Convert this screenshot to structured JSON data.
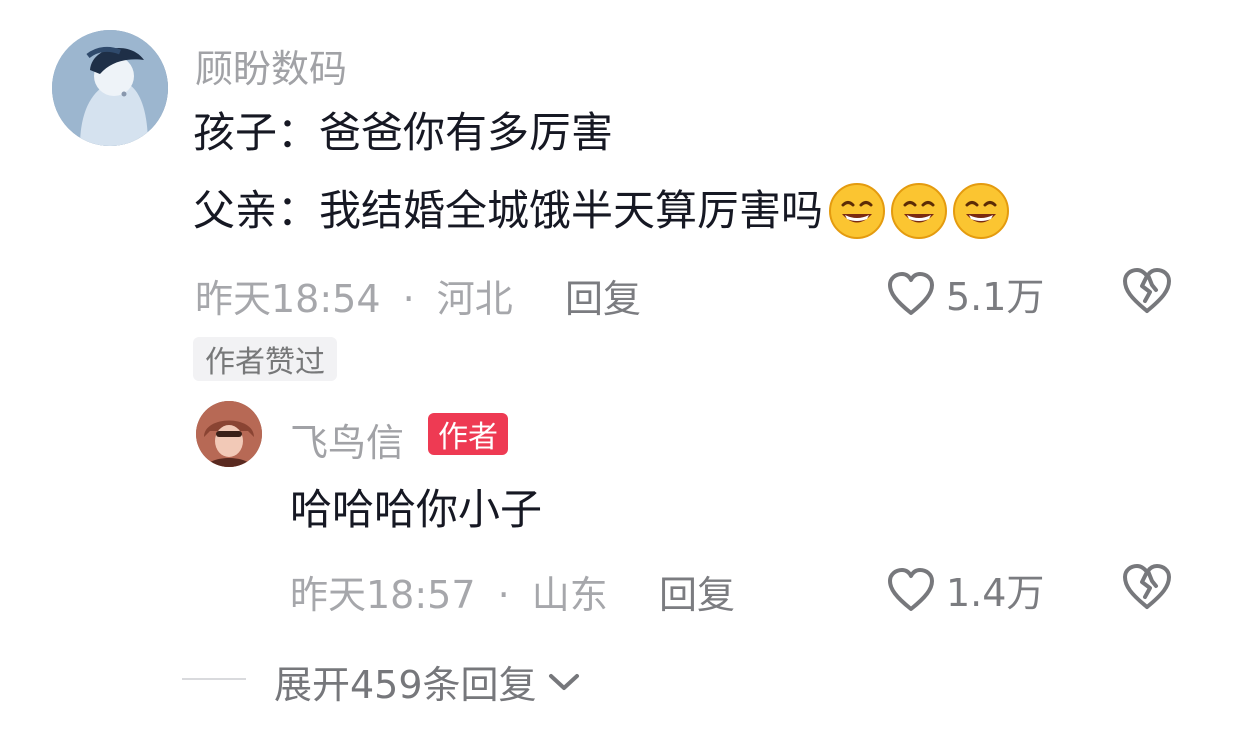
{
  "comment": {
    "username": "顾盼数码",
    "line1": "孩子：爸爸你有多厉害",
    "line2": "父亲：我结婚全城饿半天算厉害吗",
    "emojis": [
      "grin-emoji",
      "grin-emoji",
      "grin-emoji"
    ],
    "time": "昨天18:54",
    "separator": "·",
    "location": "河北",
    "reply_label": "回复",
    "likes": "5.1万",
    "author_liked_badge": "作者赞过"
  },
  "reply": {
    "username": "飞鸟信",
    "author_tag": "作者",
    "text": "哈哈哈你小子",
    "time": "昨天18:57",
    "separator": "·",
    "location": "山东",
    "reply_label": "回复",
    "likes": "1.4万"
  },
  "expand": {
    "label": "展开459条回复"
  },
  "icons": {
    "like": "heart-outline-icon",
    "dislike": "broken-heart-icon",
    "expand": "chevron-down-icon"
  },
  "colors": {
    "author_tag": "#ee3a53",
    "primary_text": "#161823",
    "secondary_text": "#a1a2a6"
  }
}
